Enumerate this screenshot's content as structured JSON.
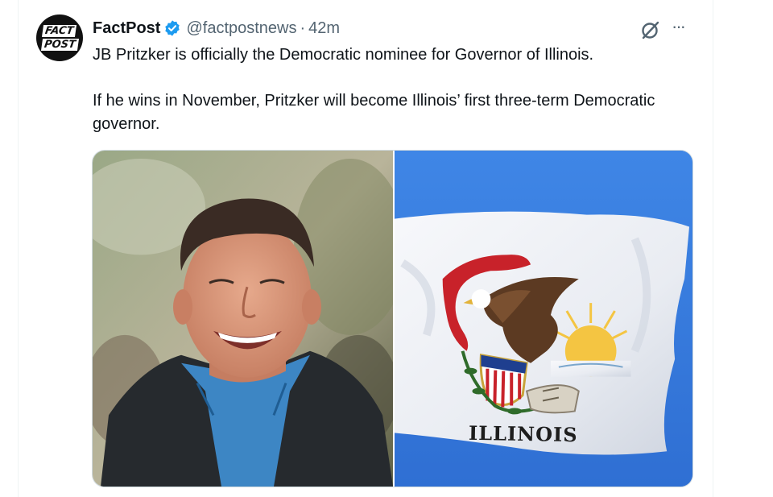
{
  "tweet": {
    "avatar": {
      "line1": "FACT",
      "line2": "POST"
    },
    "author_name": "FactPost",
    "handle": "@factpostnews",
    "separator": "·",
    "time": "42m",
    "text_line1": "JB Pritzker is officially the Democratic nominee for Governor of Illinois.",
    "text_line2": "If he wins in November, Pritzker will become Illinois’ first three-term Democratic governor.",
    "more_label": "···"
  },
  "media": {
    "left_image": "photo of smiling man in dark jacket",
    "right_image": "Illinois state flag",
    "flag_label": "ILLINOIS"
  },
  "colors": {
    "verified": "#1d9bf0",
    "secondary_text": "#536471",
    "sky": "#3d7fe0"
  }
}
